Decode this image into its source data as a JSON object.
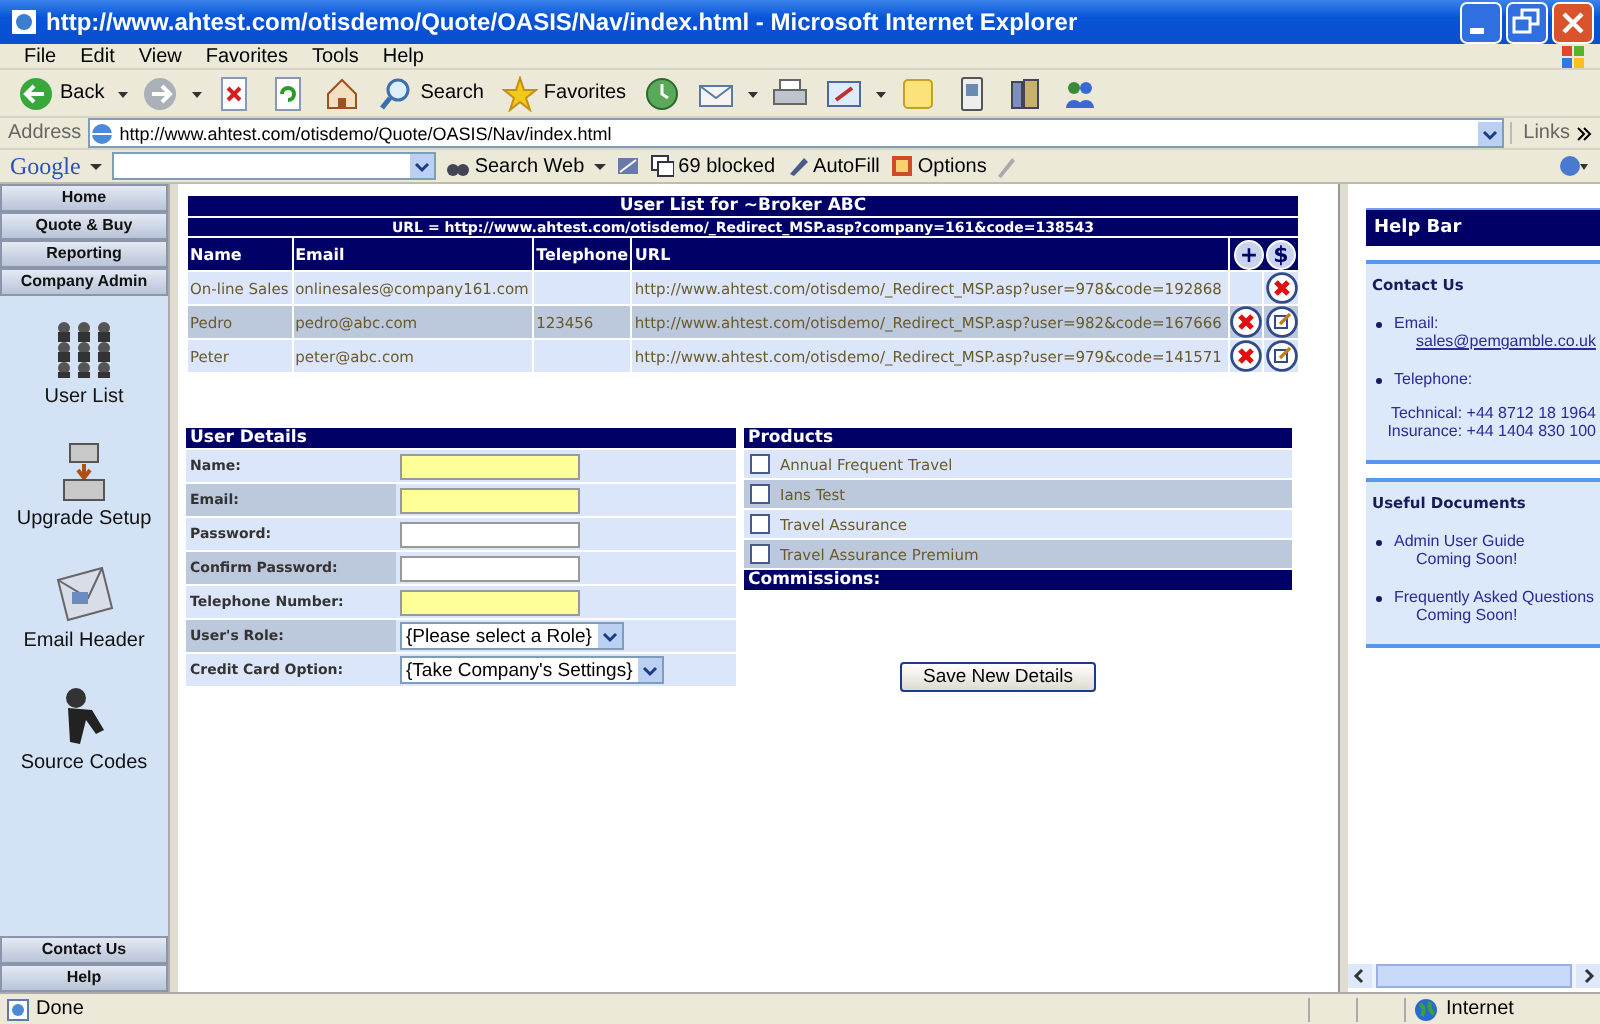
{
  "window": {
    "title": "http://www.ahtest.com/otisdemo/Quote/OASIS/Nav/index.html - Microsoft Internet Explorer"
  },
  "menu": [
    "File",
    "Edit",
    "View",
    "Favorites",
    "Tools",
    "Help"
  ],
  "toolbar": [
    {
      "kind": "back",
      "label": "Back"
    },
    {
      "kind": "forward"
    },
    {
      "kind": "stop"
    },
    {
      "kind": "refresh"
    },
    {
      "kind": "home"
    },
    {
      "kind": "search",
      "label": "Search"
    },
    {
      "kind": "favorites",
      "label": "Favorites"
    },
    {
      "kind": "history"
    },
    {
      "kind": "mail"
    },
    {
      "kind": "print"
    },
    {
      "kind": "edit"
    },
    {
      "kind": "note"
    },
    {
      "kind": "phone"
    },
    {
      "kind": "book"
    },
    {
      "kind": "people"
    }
  ],
  "address": {
    "label": "Address",
    "url": "http://www.ahtest.com/otisdemo/Quote/OASIS/Nav/index.html",
    "links": "Links"
  },
  "google_bar": {
    "logo": "Google",
    "search_web": "Search Web",
    "blocked": "69 blocked",
    "autofill": "AutoFill",
    "options": "Options"
  },
  "nav": {
    "items": [
      {
        "label": "Home"
      },
      {
        "label": "Quote & Buy"
      },
      {
        "label": "Reporting"
      },
      {
        "label": "Company Admin",
        "children": [
          {
            "kind": "users",
            "label": "User List"
          },
          {
            "kind": "upgrade",
            "label": "Upgrade Setup"
          },
          {
            "kind": "email",
            "label": "Email Header"
          },
          {
            "kind": "codes",
            "label": "Source Codes"
          }
        ]
      }
    ],
    "bottom": [
      "Contact Us",
      "Help"
    ]
  },
  "user_list": {
    "title": "User List for ~Broker ABC",
    "url": "URL = http://www.ahtest.com/otisdemo/_Redirect_MSP.asp?company=161&code=138543",
    "columns": [
      "Name",
      "Email",
      "Telephone",
      "URL"
    ],
    "header_buttons": [
      "+",
      "$"
    ],
    "rows": [
      {
        "name": "On-line Sales",
        "email": "onlinesales@company161.com",
        "url": "http://www.ahtest.com/otisdemo/_Redirect_MSP.asp?user=978&code=192868",
        "editable": false
      },
      {
        "name": "Pedro",
        "email": "pedro@abc.com",
        "telephone": "123456",
        "url": "http://www.ahtest.com/otisdemo/_Redirect_MSP.asp?user=982&code=167666",
        "editable": true
      },
      {
        "name": "Peter",
        "email": "peter@abc.com",
        "url": "http://www.ahtest.com/otisdemo/_Redirect_MSP.asp?user=979&code=141571",
        "editable": true
      }
    ]
  },
  "user_details": {
    "title": "User Details",
    "fields": [
      {
        "label": "Name:",
        "kind": "text",
        "required": true
      },
      {
        "label": "Email:",
        "kind": "text",
        "required": true
      },
      {
        "label": "Password:",
        "kind": "text",
        "required": false
      },
      {
        "label": "Confirm Password:",
        "kind": "text",
        "required": false
      },
      {
        "label": "Telephone Number:",
        "kind": "text",
        "required": true
      },
      {
        "label": "User's Role:",
        "kind": "select",
        "value": "{Please select a Role}"
      },
      {
        "label": "Credit Card Option:",
        "kind": "select",
        "value": "{Take Company's Settings}"
      }
    ]
  },
  "products": {
    "title": "Products",
    "items": [
      {
        "label": "Annual Frequent Travel",
        "checked": false
      },
      {
        "label": "Ians Test",
        "checked": false
      },
      {
        "label": "Travel Assurance",
        "checked": false
      },
      {
        "label": "Travel Assurance Premium",
        "checked": false
      }
    ],
    "commissions": "Commissions:"
  },
  "save_button": "Save New Details",
  "help_bar": {
    "title": "Help Bar",
    "contact": {
      "title": "Contact Us",
      "email_label": "Email:",
      "email": "sales@pemgamble.co.uk",
      "telephone_label": "Telephone:",
      "lines": [
        "Technical: +44 8712 18 1964",
        "Insurance: +44 1404 830 100"
      ]
    },
    "documents": {
      "title": "Useful Documents",
      "items": [
        {
          "title": "Admin User Guide",
          "note": "Coming Soon!"
        },
        {
          "title": "Frequently Asked Questions",
          "note": "Coming Soon!"
        }
      ]
    }
  },
  "status_bar": {
    "text": "Done",
    "zone": "Internet"
  }
}
